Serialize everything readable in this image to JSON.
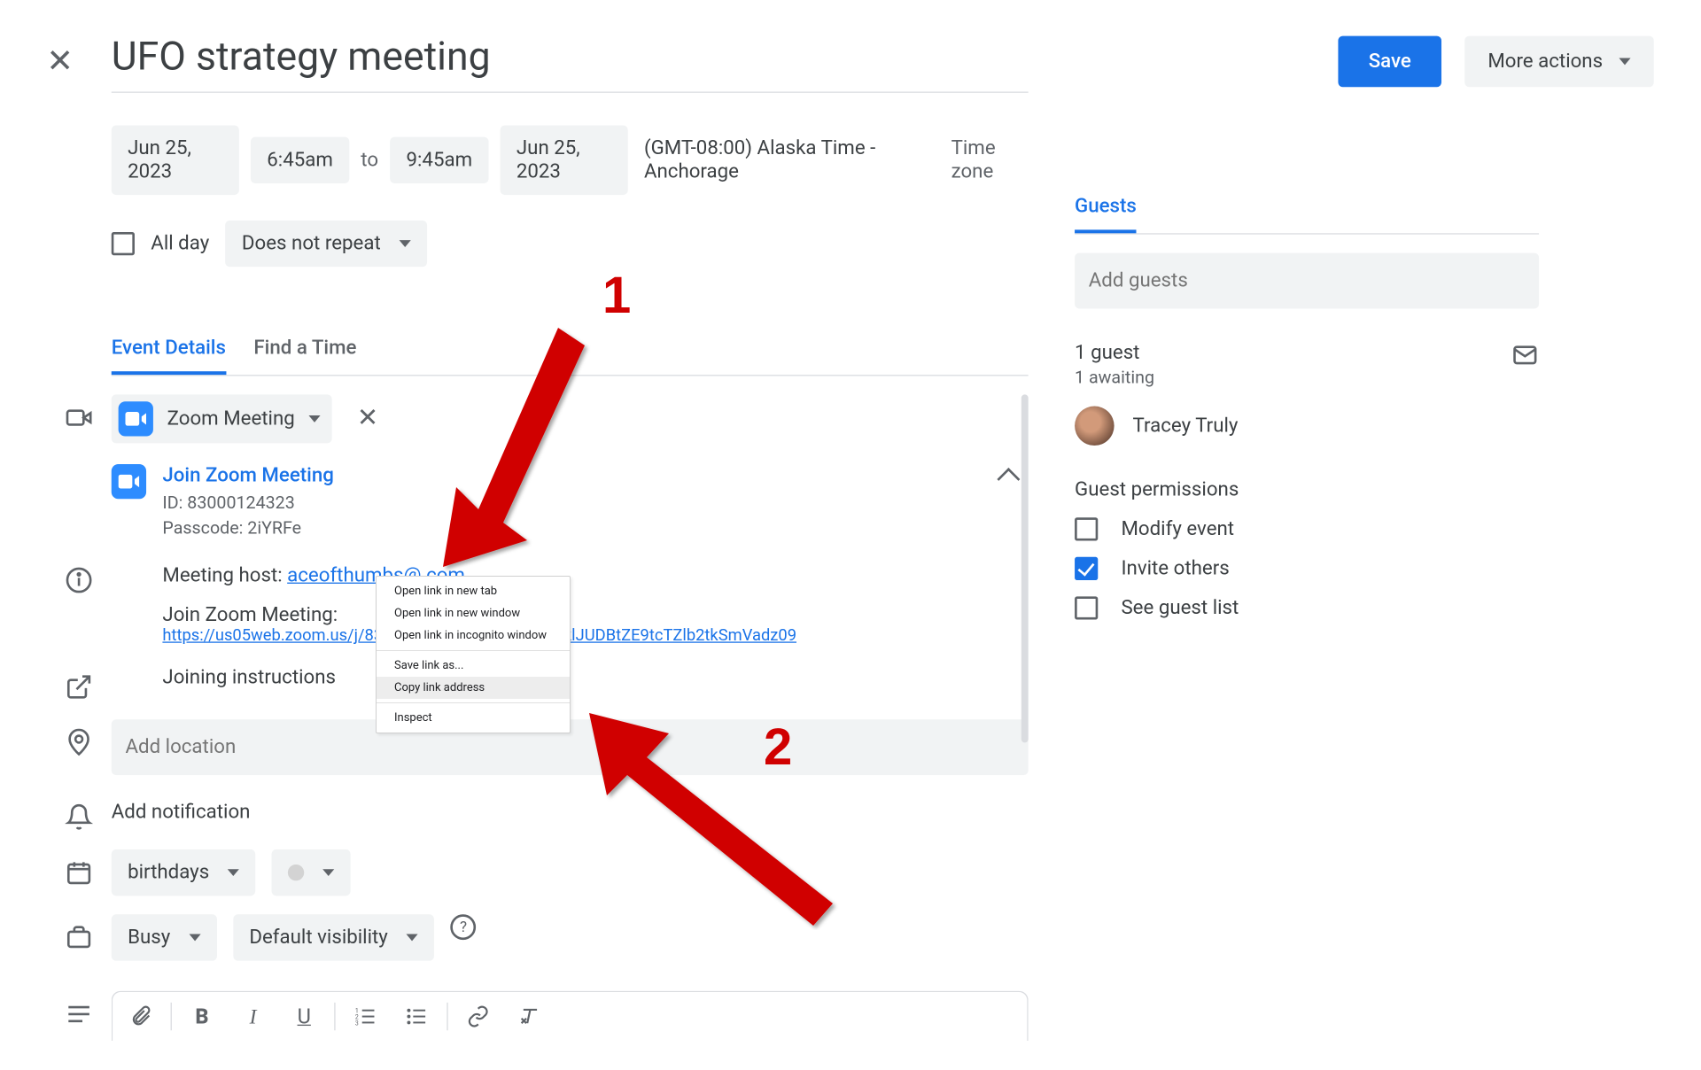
{
  "header": {
    "title": "UFO strategy meeting",
    "save": "Save",
    "more": "More actions"
  },
  "time": {
    "start_date": "Jun 25, 2023",
    "start_time": "6:45am",
    "to": "to",
    "end_time": "9:45am",
    "end_date": "Jun 25, 2023",
    "tz": "(GMT-08:00) Alaska Time - Anchorage",
    "tz_link": "Time zone"
  },
  "allday": {
    "label": "All day",
    "repeat": "Does not repeat"
  },
  "tabs": {
    "details": "Event Details",
    "find": "Find a Time"
  },
  "conf": {
    "chip": "Zoom Meeting",
    "join": "Join Zoom Meeting",
    "id": "ID: 83000124323",
    "pass": "Passcode: 2iYRFe",
    "host_label": "Meeting host: ",
    "host_email": "aceofthumbs@        com",
    "join_label": "Join Zoom Meeting:",
    "url": "https://us05web.zoom.us/j/83000124323?pwd=M3c0PklJUDBtZE9tcTZlb2tkSmVadz09",
    "joining": "Joining instructions"
  },
  "location_placeholder": "Add location",
  "notification": "Add notification",
  "calendar": {
    "name": "birthdays",
    "busy": "Busy",
    "visibility": "Default visibility"
  },
  "context_menu": {
    "open_tab": "Open link in new tab",
    "open_win": "Open link in new window",
    "open_incog": "Open link in incognito window",
    "save_as": "Save link as...",
    "copy": "Copy link address",
    "inspect": "Inspect"
  },
  "annotations": {
    "one": "1",
    "two": "2"
  },
  "guests": {
    "tab": "Guests",
    "placeholder": "Add guests",
    "count": "1 guest",
    "awaiting": "1 awaiting",
    "attendee": "Tracey Truly",
    "perm_head": "Guest permissions",
    "perm_modify": "Modify event",
    "perm_invite": "Invite others",
    "perm_see": "See guest list"
  }
}
